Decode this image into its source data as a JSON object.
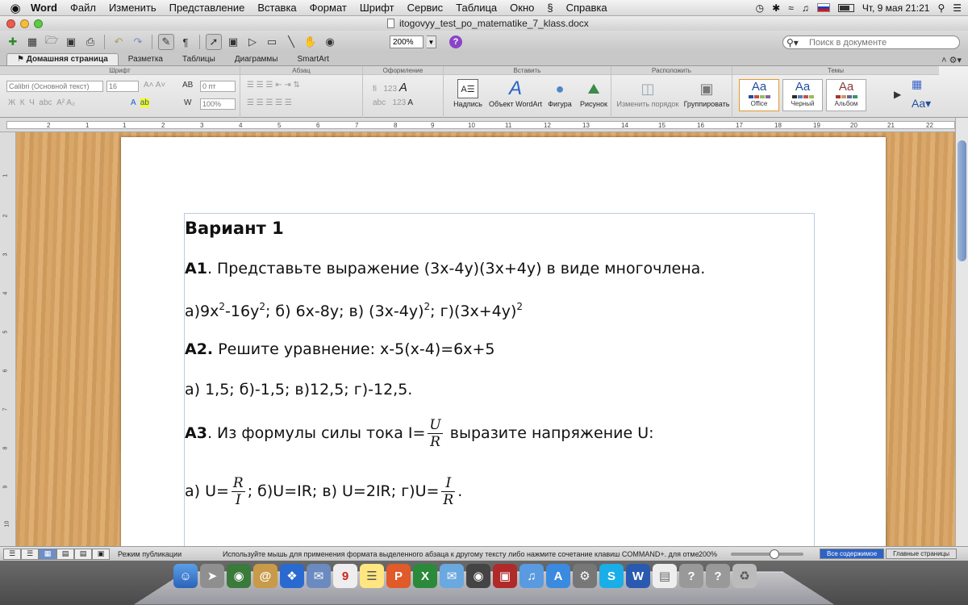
{
  "menubar": {
    "apple": "",
    "app": "Word",
    "items": [
      "Файл",
      "Изменить",
      "Представление",
      "Вставка",
      "Формат",
      "Шрифт",
      "Сервис",
      "Таблица",
      "Окно",
      "Справка"
    ],
    "datetime": "Чт, 9 мая  21:21"
  },
  "window": {
    "title": "itogovyy_test_po_matematike_7_klass.docx"
  },
  "toolbar": {
    "zoom": "200%",
    "help": "?",
    "search_placeholder": "Поиск в документе"
  },
  "ribbon_tabs": [
    "Домашняя страница",
    "Разметка",
    "Таблицы",
    "Диаграммы",
    "SmartArt"
  ],
  "ribbon": {
    "groups": {
      "font": "Шрифт",
      "paragraph": "Абзац",
      "styles": "Оформление",
      "insert": "Вставить",
      "arrange": "Расположить",
      "themes": "Темы"
    },
    "font_name": "Calibri (Основной текст)",
    "font_size": "16",
    "spacing": "0 пт",
    "scale": "100%",
    "insert_buttons": [
      "Надпись",
      "Объект WordArt",
      "Фигура",
      "Рисунок"
    ],
    "arrange_buttons": [
      "Изменить порядок",
      "Группировать"
    ],
    "themes": [
      "Office",
      "Черный",
      "Альбом"
    ],
    "theme_sample": "Aa"
  },
  "ruler_numbers": [
    "2",
    "1",
    "1",
    "2",
    "3",
    "4",
    "5",
    "6",
    "7",
    "8",
    "9",
    "10",
    "11",
    "12",
    "13",
    "14",
    "15",
    "16",
    "17",
    "18",
    "19",
    "20",
    "21",
    "22"
  ],
  "document": {
    "heading": "Вариант 1",
    "a1_label": "А1",
    "a1_text": ". Представьте выражение (3х-4у)(3х+4у) в виде многочлена.",
    "a1_opt_a": "а)9х",
    "a1_opt_a2": "-16у",
    "a1_opt_rest1": ";   б) 6х-8у;  в) (3х-4у)",
    "a1_opt_rest2": ";  г)(3х+4у)",
    "sup2": "2",
    "a2_label": "А2.",
    "a2_text": " Решите уравнение: х-5(х-4)=6х+5",
    "a2_options": "а) 1,5;  б)-1,5;  в)12,5;  г)-12,5.",
    "a3_label": "А3",
    "a3_text_before": ". Из формулы силы тока  I=",
    "a3_text_after": " выразите напряжение U:",
    "frac_u": "U",
    "frac_r": "R",
    "frac_i": "I",
    "a3_opt_a": "а) U=",
    "a3_opt_mid": "; б)U=IR; в) U=2IR; г)U=",
    "a3_opt_end": "."
  },
  "statusbar": {
    "mode": "Режим публикации",
    "hint": "Используйте мышь для применения формата выделенного абзаца к другому тексту либо нажмите сочетание клавиш COMMAND+. для отмены.",
    "zoom": "200%",
    "tab_all": "Все содержимое",
    "tab_master": "Главные страницы"
  },
  "colors": {
    "accent": "#2e62c4",
    "wood": "#d9a76a",
    "close": "#ee5a4f",
    "minimize": "#f5bd3b",
    "maximize": "#5ccb45"
  }
}
